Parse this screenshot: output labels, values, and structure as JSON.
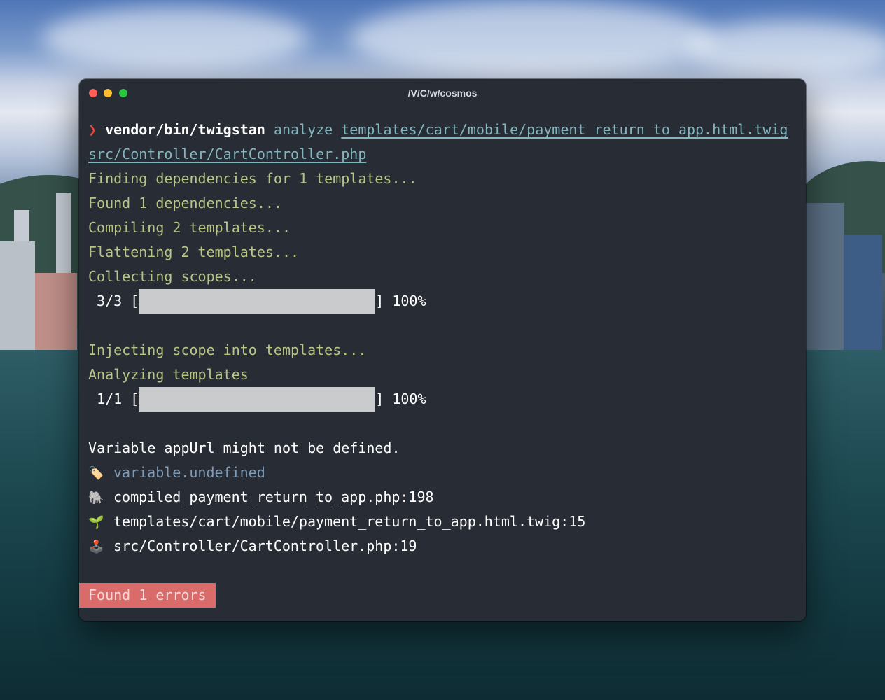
{
  "window": {
    "title": "/V/C/w/cosmos"
  },
  "terminal": {
    "prompt_symbol": "❯",
    "command": "vendor/bin/twigstan",
    "subcommand": "analyze",
    "arg_template": "templates/cart/mobile/payment_return_to_app.html.twig",
    "arg_controller": "src/Controller/CartController.php",
    "output": [
      "Finding dependencies for 1 templates...",
      "Found 1 dependencies...",
      "Compiling 2 templates...",
      "Flattening 2 templates...",
      "Collecting scopes..."
    ],
    "progress1": {
      "count": " 3/3 [",
      "close": "]",
      "percent": " 100%",
      "fraction": 1.0
    },
    "inject": "Injecting scope into templates...",
    "analyze": "Analyzing templates",
    "progress2": {
      "count": " 1/1 [",
      "close": "]",
      "percent": " 100%",
      "fraction": 1.0
    },
    "error_message": "Variable appUrl might not be defined.",
    "details": [
      {
        "icon": "tag-icon",
        "glyph": "🏷️",
        "text": "variable.undefined",
        "style": "ident"
      },
      {
        "icon": "elephant-icon",
        "glyph": "🐘",
        "text": "compiled_payment_return_to_app.php:198",
        "style": "plain"
      },
      {
        "icon": "seedling-icon",
        "glyph": "🌱",
        "text": "templates/cart/mobile/payment_return_to_app.html.twig:15",
        "style": "plain"
      },
      {
        "icon": "joystick-icon",
        "glyph": "🕹️",
        "text": "src/Controller/CartController.php:19",
        "style": "plain"
      }
    ],
    "summary": "Found 1 errors"
  },
  "colors": {
    "terminal_bg": "#282c34",
    "info_green": "#b8c584",
    "path_cyan": "#83b5bf",
    "error_red": "#d96b6b",
    "prompt_red": "#e8463c"
  }
}
